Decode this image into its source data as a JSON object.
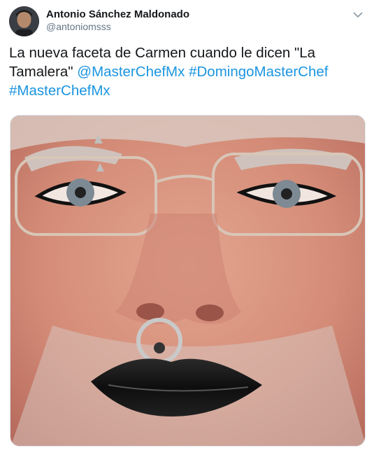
{
  "author": {
    "display_name": "Antonio Sánchez Maldonado",
    "handle": "@antoniomsss",
    "avatar": "profile-photo"
  },
  "tweet": {
    "text_prefix": "La nueva faceta de Carmen cuando le dicen \"La Tamalera\" ",
    "mention": "@MasterChefMx",
    "hashtag_1": "#DomingoMasterChef",
    "hashtag_2": "#MasterChefMx"
  },
  "icons": {
    "more_menu": "chevron-down-icon"
  },
  "colors": {
    "link": "#1b95e0",
    "name": "#14171a",
    "handle": "#657786"
  },
  "media": {
    "type": "photo",
    "description_hidden": true
  }
}
